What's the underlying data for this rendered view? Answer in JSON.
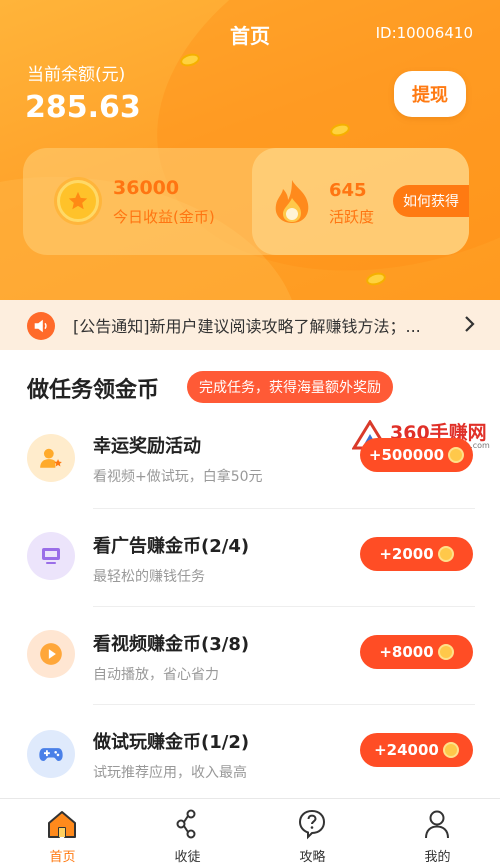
{
  "header": {
    "title": "首页",
    "user_id": "ID:10006410",
    "balance_label": "当前余额(元)",
    "balance_value": "285.63",
    "withdraw_label": "提现",
    "accent_color": "#ffa22a"
  },
  "stats": {
    "coins_value": "36000",
    "coins_label": "今日收益(金币)",
    "activity_value": "645",
    "activity_label": "活跃度",
    "how_to_get_label": "如何获得"
  },
  "notice": {
    "text": "[公告通知]新用户建议阅读攻略了解赚钱方法；...",
    "icon": "speaker-icon"
  },
  "tasks_section": {
    "title": "做任务领金币",
    "badge": "完成任务，获得海量额外奖励",
    "items": [
      {
        "title": "幸运奖励活动",
        "desc": "看视频+做试玩，白拿50元",
        "reward": "+500000",
        "icon": "user-star-icon",
        "icon_bg": "#ffeccc"
      },
      {
        "title": "看广告赚金币(2/4)",
        "desc": "最轻松的赚钱任务",
        "reward": "+2000",
        "icon": "monitor-icon",
        "icon_bg": "#ece4fb"
      },
      {
        "title": "看视频赚金币(3/8)",
        "desc": "自动播放，省心省力",
        "reward": "+8000",
        "icon": "play-icon",
        "icon_bg": "#ffe6d2"
      },
      {
        "title": "做试玩赚金币(1/2)",
        "desc": "试玩推荐应用，收入最高",
        "reward": "+24000",
        "icon": "gamepad-icon",
        "icon_bg": "#dfeafc"
      }
    ]
  },
  "watermark": {
    "main": "360手赚网",
    "sub": "www.360shouzhuan.com"
  },
  "tabbar": {
    "items": [
      {
        "label": "首页",
        "icon": "home-icon",
        "active": true
      },
      {
        "label": "收徒",
        "icon": "share-icon",
        "active": false
      },
      {
        "label": "攻略",
        "icon": "question-icon",
        "active": false
      },
      {
        "label": "我的",
        "icon": "user-icon",
        "active": false
      }
    ],
    "active_color": "#ff7a12"
  }
}
